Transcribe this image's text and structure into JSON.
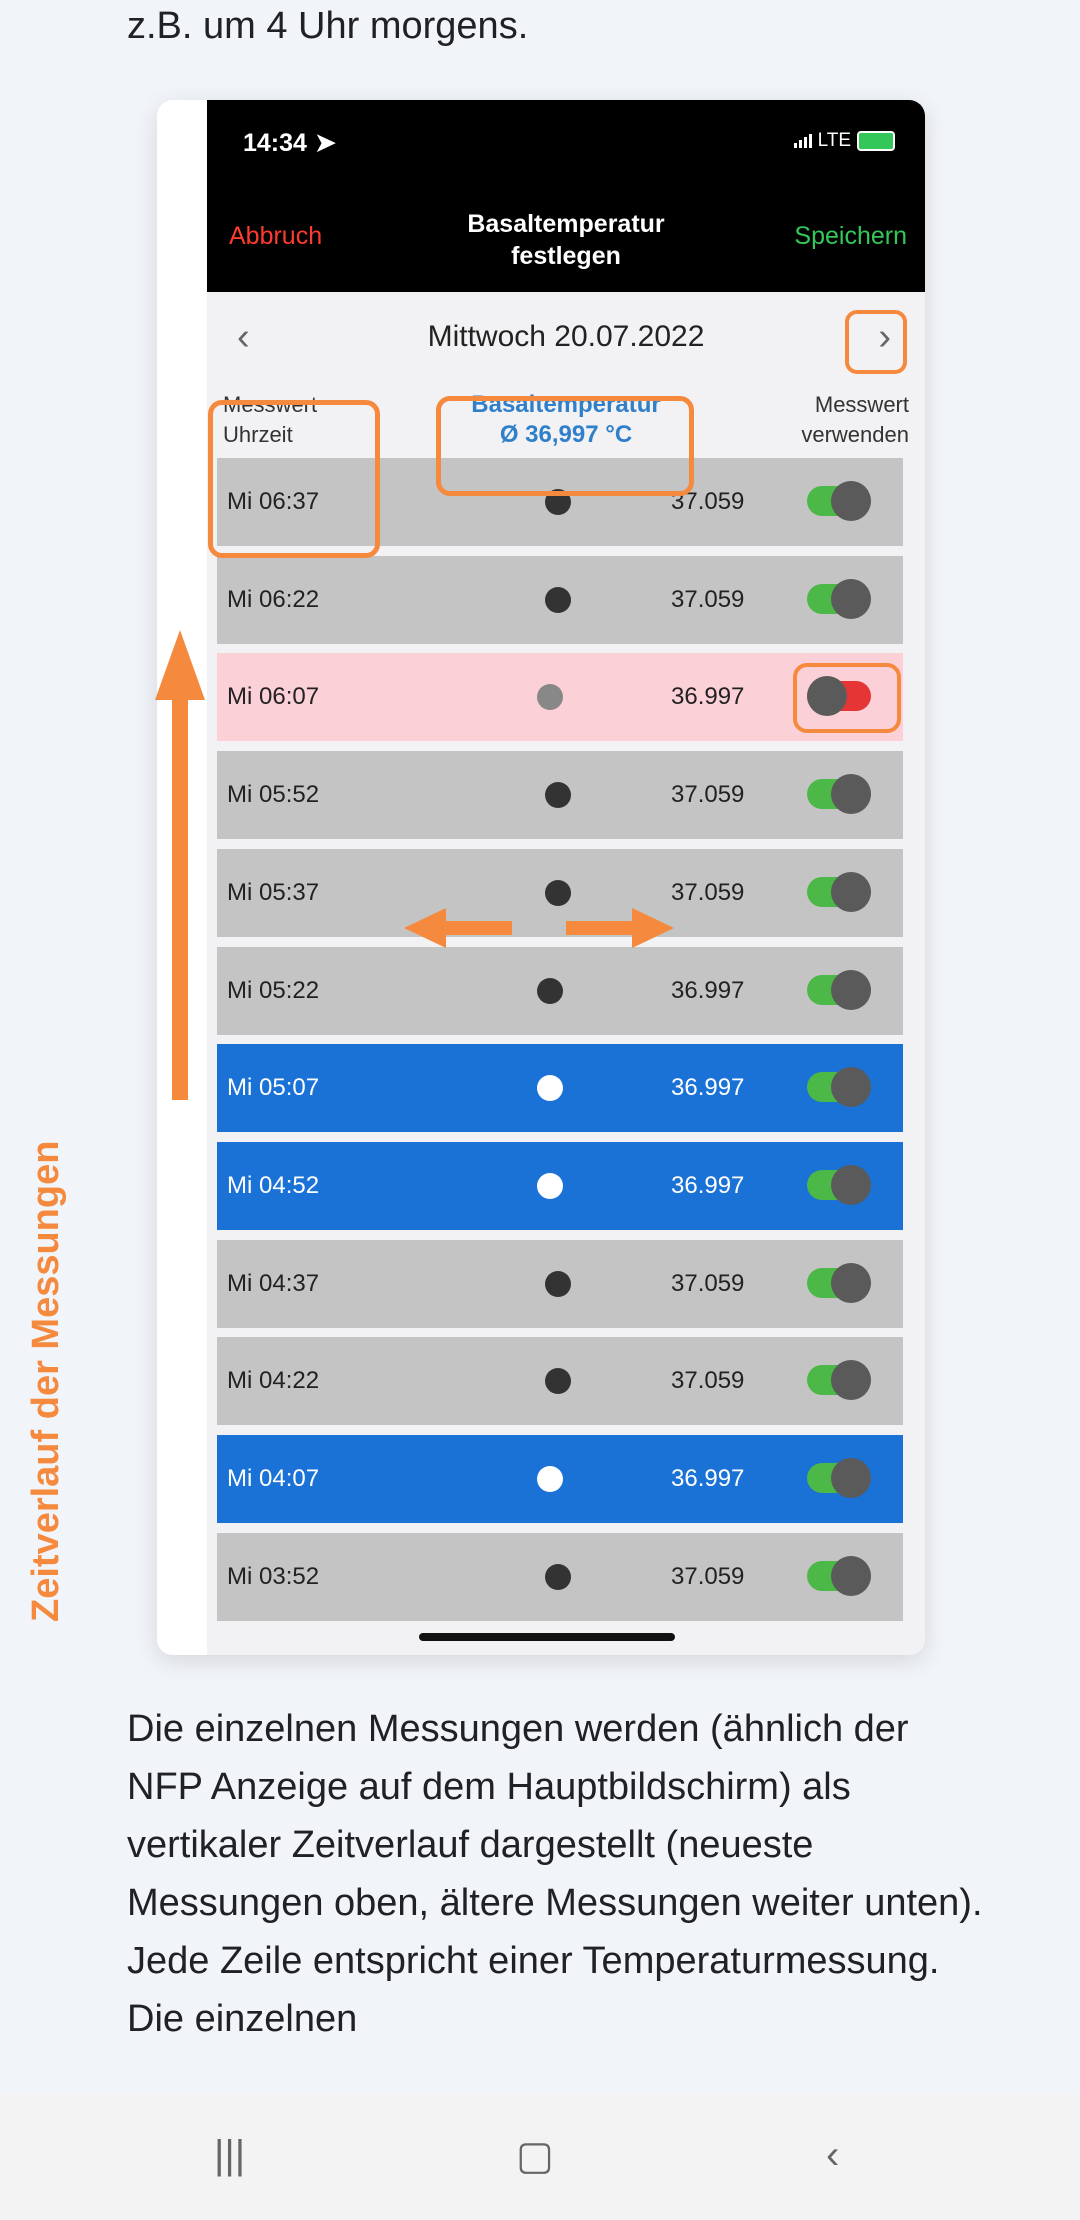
{
  "article": {
    "top_text": "z.B. um 4 Uhr morgens.",
    "body_text": "Die einzelnen Messungen werden (ähnlich der NFP Anzeige auf dem Hauptbildschirm) als vertikaler Zeitverlauf dargestellt (neueste Messungen oben, ältere Messungen weiter unten). Jede Zeile entspricht einer Temperaturmessung. Die einzelnen"
  },
  "annotation": {
    "side_label": "Zeitverlauf der Messungen"
  },
  "status_bar": {
    "time": "14:34",
    "network": "LTE"
  },
  "nav": {
    "cancel": "Abbruch",
    "title_line1": "Basaltemperatur",
    "title_line2": "festlegen",
    "save": "Speichern"
  },
  "date_bar": {
    "date": "Mittwoch 20.07.2022"
  },
  "headers": {
    "time_line1": "Messwert",
    "time_line2": "Uhrzeit",
    "basal_line1": "Basaltemperatur",
    "basal_line2": "Ø 36,997 °C",
    "use_line1": "Messwert",
    "use_line2": "verwenden"
  },
  "rows": [
    {
      "time": "Mi 06:37",
      "value": "37.059",
      "style": "gray",
      "on": true
    },
    {
      "time": "Mi 06:22",
      "value": "37.059",
      "style": "gray",
      "on": true
    },
    {
      "time": "Mi 06:07",
      "value": "36.997",
      "style": "pink",
      "on": false
    },
    {
      "time": "Mi 05:52",
      "value": "37.059",
      "style": "gray",
      "on": true
    },
    {
      "time": "Mi 05:37",
      "value": "37.059",
      "style": "gray",
      "on": true
    },
    {
      "time": "Mi 05:22",
      "value": "36.997",
      "style": "gray",
      "on": true
    },
    {
      "time": "Mi 05:07",
      "value": "36.997",
      "style": "blue",
      "on": true
    },
    {
      "time": "Mi 04:52",
      "value": "36.997",
      "style": "blue",
      "on": true
    },
    {
      "time": "Mi 04:37",
      "value": "37.059",
      "style": "gray",
      "on": true
    },
    {
      "time": "Mi 04:22",
      "value": "37.059",
      "style": "gray",
      "on": true
    },
    {
      "time": "Mi 04:07",
      "value": "36.997",
      "style": "blue",
      "on": true
    },
    {
      "time": "Mi 03:52",
      "value": "37.059",
      "style": "gray",
      "on": true
    }
  ],
  "colors": {
    "annotation": "#f58a3f",
    "highlight_blue": "#1b72d6",
    "excluded_pink": "#fbd0d6",
    "toggle_on": "#4cb848",
    "toggle_off": "#e63535"
  }
}
